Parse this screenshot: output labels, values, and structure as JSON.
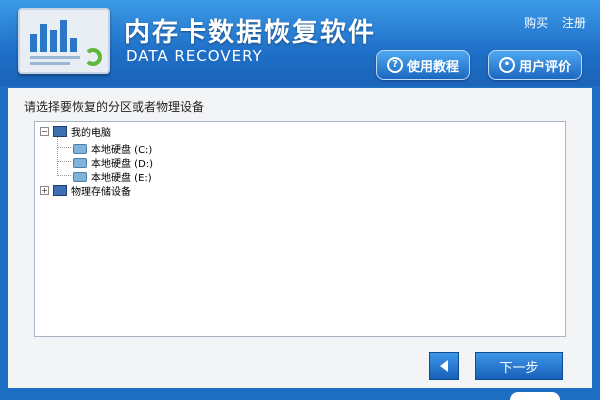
{
  "app": {
    "title": "内存卡数据恢复软件",
    "subtitle": "DATA RECOVERY"
  },
  "top_links": {
    "buy": "购买",
    "register": "注册"
  },
  "header_buttons": {
    "tutorial": "使用教程",
    "rating": "用户评价"
  },
  "content": {
    "prompt": "请选择要恢复的分区或者物理设备"
  },
  "tree": {
    "computer": {
      "label": "我的电脑",
      "expanded": true,
      "expander": "−"
    },
    "disks": [
      {
        "label": "本地硬盘 (C:)"
      },
      {
        "label": "本地硬盘 (D:)"
      },
      {
        "label": "本地硬盘 (E:)"
      }
    ],
    "physical": {
      "label": "物理存储设备",
      "expanded": false,
      "expander": "+"
    }
  },
  "footer": {
    "next": "下一步"
  },
  "colors": {
    "header_top": "#3b9ae6",
    "header_bottom": "#1a63b8",
    "button_blue": "#1860b8"
  }
}
